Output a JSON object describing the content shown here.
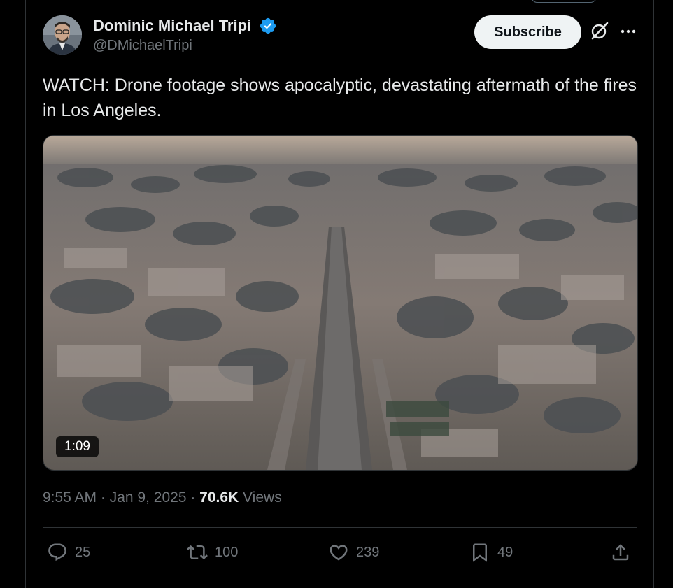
{
  "author": {
    "name": "Dominic Michael Tripi",
    "handle": "@DMichaelTripi",
    "verified_color": "#1d9bf0"
  },
  "header": {
    "subscribe_label": "Subscribe",
    "icons": [
      "grok-icon",
      "more-icon"
    ]
  },
  "post": {
    "text": "WATCH: Drone footage shows apocalyptic, devastating aftermath of the fires in Los Angeles.",
    "video": {
      "duration": "1:09"
    }
  },
  "meta": {
    "time": "9:55 AM",
    "separator1": " · ",
    "date": "Jan 9, 2025",
    "separator2": " · ",
    "views_count": "70.6K",
    "views_label": " Views"
  },
  "actions": {
    "replies": "25",
    "reposts": "100",
    "likes": "239",
    "bookmarks": "49"
  },
  "colors": {
    "background": "#000000",
    "text_primary": "#e7e9ea",
    "text_secondary": "#71767b",
    "border": "#2f3336"
  }
}
